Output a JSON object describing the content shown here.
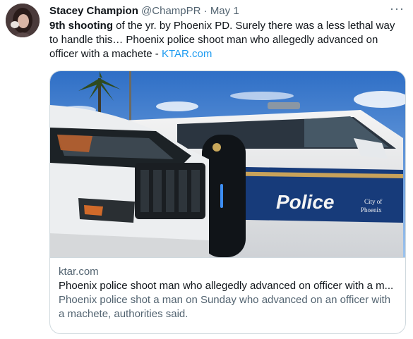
{
  "tweet": {
    "author_name": "Stacey Champion",
    "author_handle": "@ChampPR",
    "separator": "·",
    "timestamp": "May 1",
    "more_label": "···",
    "text_bold": "9th shooting",
    "text_main": " of the yr. by Phoenix PD. Surely there was a less lethal way to handle this… Phoenix police shoot man who allegedly advanced on officer with a machete - ",
    "text_link": "KTAR.com"
  },
  "card": {
    "domain": "ktar.com",
    "title": "Phoenix police shoot man who allegedly advanced on officer with a m...",
    "description": "Phoenix police shot a man on Sunday who advanced on an officer with a machete, authorities said.",
    "image": {
      "door_text": "Police",
      "door_small_line1": "City of",
      "door_small_line2": "Phoenix"
    }
  },
  "colors": {
    "link": "#1d9bf0",
    "muted": "#536471",
    "border": "#cfd9de"
  }
}
